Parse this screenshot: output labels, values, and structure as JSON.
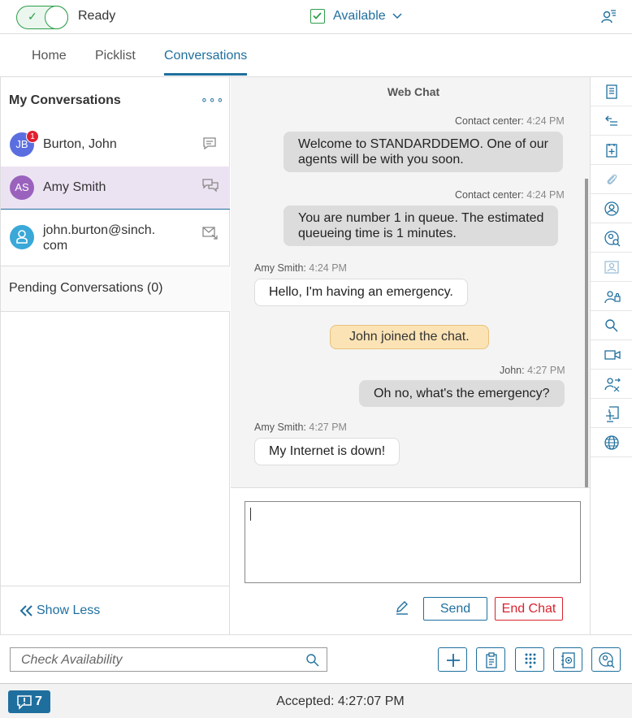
{
  "topbar": {
    "ready_label": "Ready",
    "availability_label": "Available"
  },
  "tabs": [
    {
      "label": "Home"
    },
    {
      "label": "Picklist"
    },
    {
      "label": "Conversations",
      "active": true
    }
  ],
  "sidebar": {
    "title": "My Conversations",
    "more": "∘∘∘",
    "items": [
      {
        "initials": "JB",
        "name": "Burton, John",
        "badge": "1",
        "icon": "chat-icon"
      },
      {
        "initials": "AS",
        "name": "Amy Smith",
        "icon": "conversation-icon",
        "selected": true
      },
      {
        "name_line1": "john.burton@sinch.",
        "name_line2": "com",
        "icon": "email-icon"
      }
    ],
    "pending_label": "Pending Conversations (0)",
    "show_less_label": "Show Less"
  },
  "chat": {
    "title": "Web Chat",
    "messages": [
      {
        "sender": "Contact center:",
        "time": "4:24 PM",
        "line1": "Welcome to STANDARDDEMO. One of our",
        "line2": "agents will be with you soon."
      },
      {
        "sender": "Contact center:",
        "time": "4:24 PM",
        "line1": "You are number 1 in queue. The estimated",
        "line2": "queueing time is 1 minutes."
      },
      {
        "sender": "Amy Smith:",
        "time": "4:24 PM",
        "text": "Hello, I'm having an emergency."
      },
      {
        "system": "John joined the chat."
      },
      {
        "sender": "John:",
        "time": "4:27 PM",
        "text": "Oh no, what's the emergency?"
      },
      {
        "sender": "Amy Smith:",
        "time": "4:27 PM",
        "text": "My Internet is down!"
      }
    ],
    "input_value": "",
    "send_label": "Send",
    "end_label": "End Chat"
  },
  "bottombar": {
    "check_placeholder": "Check Availability"
  },
  "status": {
    "notification_count": "7",
    "accepted_text": "Accepted: 4:27:07 PM"
  },
  "colors": {
    "accent": "#1f6f9e",
    "ready_green": "#2e9e4a",
    "end_red": "#d9232d",
    "system_bubble": "#fbe3b5"
  }
}
